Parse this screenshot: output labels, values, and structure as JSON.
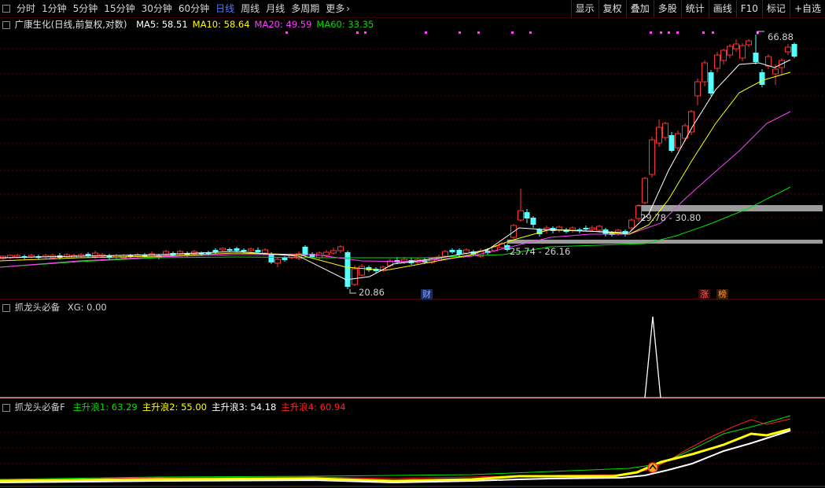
{
  "toolbar": {
    "periods": [
      {
        "label": "分时",
        "active": false
      },
      {
        "label": "1分钟",
        "active": false
      },
      {
        "label": "5分钟",
        "active": false
      },
      {
        "label": "15分钟",
        "active": false
      },
      {
        "label": "30分钟",
        "active": false
      },
      {
        "label": "60分钟",
        "active": false
      },
      {
        "label": "日线",
        "active": true
      },
      {
        "label": "周线",
        "active": false
      },
      {
        "label": "月线",
        "active": false
      },
      {
        "label": "多周期",
        "active": false
      },
      {
        "label": "更多",
        "active": false
      }
    ],
    "right_buttons": [
      "显示",
      "复权",
      "叠加",
      "多股",
      "统计",
      "画线",
      "F10",
      "标记",
      "+自选"
    ]
  },
  "main": {
    "title": "广康生化(日线,前复权,对数)",
    "ma": [
      {
        "label": "MA5: 58.51",
        "color": "#ffffff"
      },
      {
        "label": "MA10: 58.64",
        "color": "#ffff00"
      },
      {
        "label": "MA20: 49.59",
        "color": "#ff40ff"
      },
      {
        "label": "MA60: 33.35",
        "color": "#00e000"
      }
    ],
    "price_high_label": "66.88",
    "price_low_label": "20.86",
    "zone_upper_label": "29.78 - 30.80",
    "zone_lower_label": "25.74 - 26.16",
    "marker_cai": "财",
    "marker_zhang": "涨",
    "marker_bang": "榜"
  },
  "ind1": {
    "title": "抓龙头必备",
    "xg": "XG: 0.00"
  },
  "ind2": {
    "title": "抓龙头必备F",
    "lines": [
      {
        "label": "主升浪1: 63.29",
        "color": "#00e000"
      },
      {
        "label": "主升浪2: 55.00",
        "color": "#ffff00"
      },
      {
        "label": "主升浪3: 54.18",
        "color": "#ffffff"
      },
      {
        "label": "主升浪4: 60.94",
        "color": "#ff2020"
      }
    ]
  },
  "colors": {
    "up": "#ff3333",
    "down": "#54ffff",
    "grid": "#5a0000",
    "zone": "#9c9c9c"
  }
}
